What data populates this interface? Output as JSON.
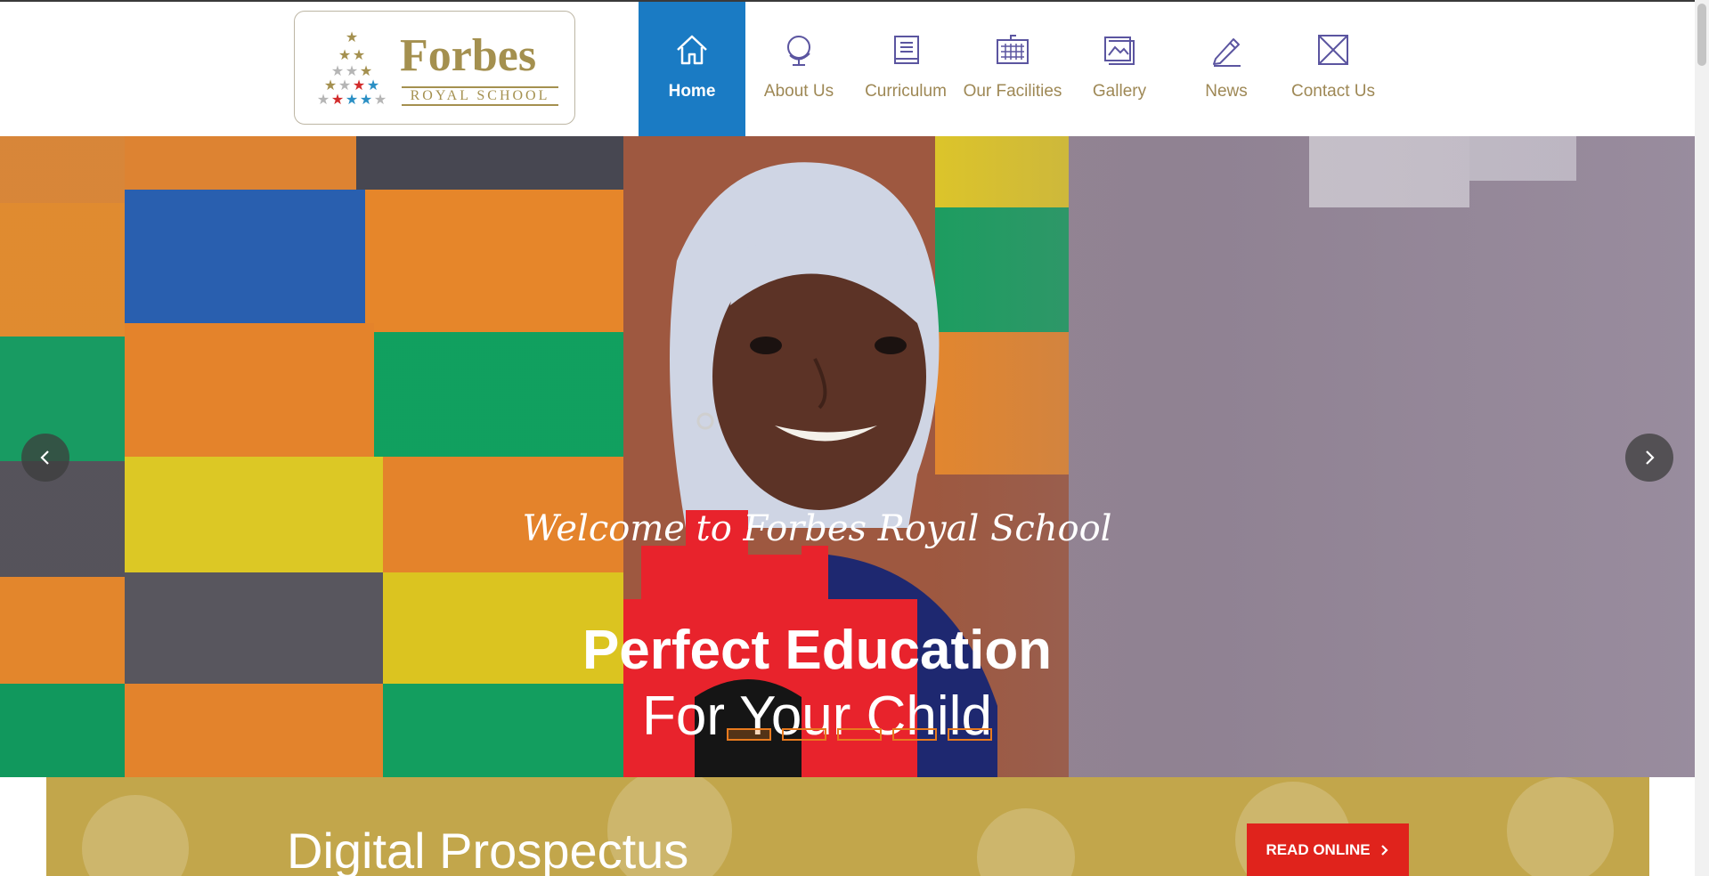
{
  "brand": {
    "name": "Forbes",
    "tagline": "ROYAL SCHOOL",
    "colors": {
      "gold": "#a4904f",
      "blue": "#1a7bc4",
      "red": "#e0231c",
      "orange": "#e87a1e"
    }
  },
  "nav": {
    "items": [
      {
        "label": "Home",
        "icon": "home-icon",
        "active": true
      },
      {
        "label": "About Us",
        "icon": "globe-icon",
        "active": false
      },
      {
        "label": "Curriculum",
        "icon": "book-icon",
        "active": false
      },
      {
        "label": "Our Facilities",
        "icon": "keyboard-icon",
        "active": false
      },
      {
        "label": "Gallery",
        "icon": "image-icon",
        "active": false
      },
      {
        "label": "News",
        "icon": "pencil-icon",
        "active": false
      },
      {
        "label": "Contact Us",
        "icon": "envelope-icon",
        "active": false
      }
    ]
  },
  "hero": {
    "welcome": "Welcome to Forbes Royal School",
    "headline": "Perfect Education",
    "subline": "For Your Child",
    "prev_icon": "chevron-left-icon",
    "next_icon": "chevron-right-icon",
    "slides_total": 5,
    "active_slide": 1
  },
  "prospectus": {
    "title": "Digital Prospectus",
    "button_label": "READ ONLINE",
    "button_icon": "chevron-right-icon"
  }
}
